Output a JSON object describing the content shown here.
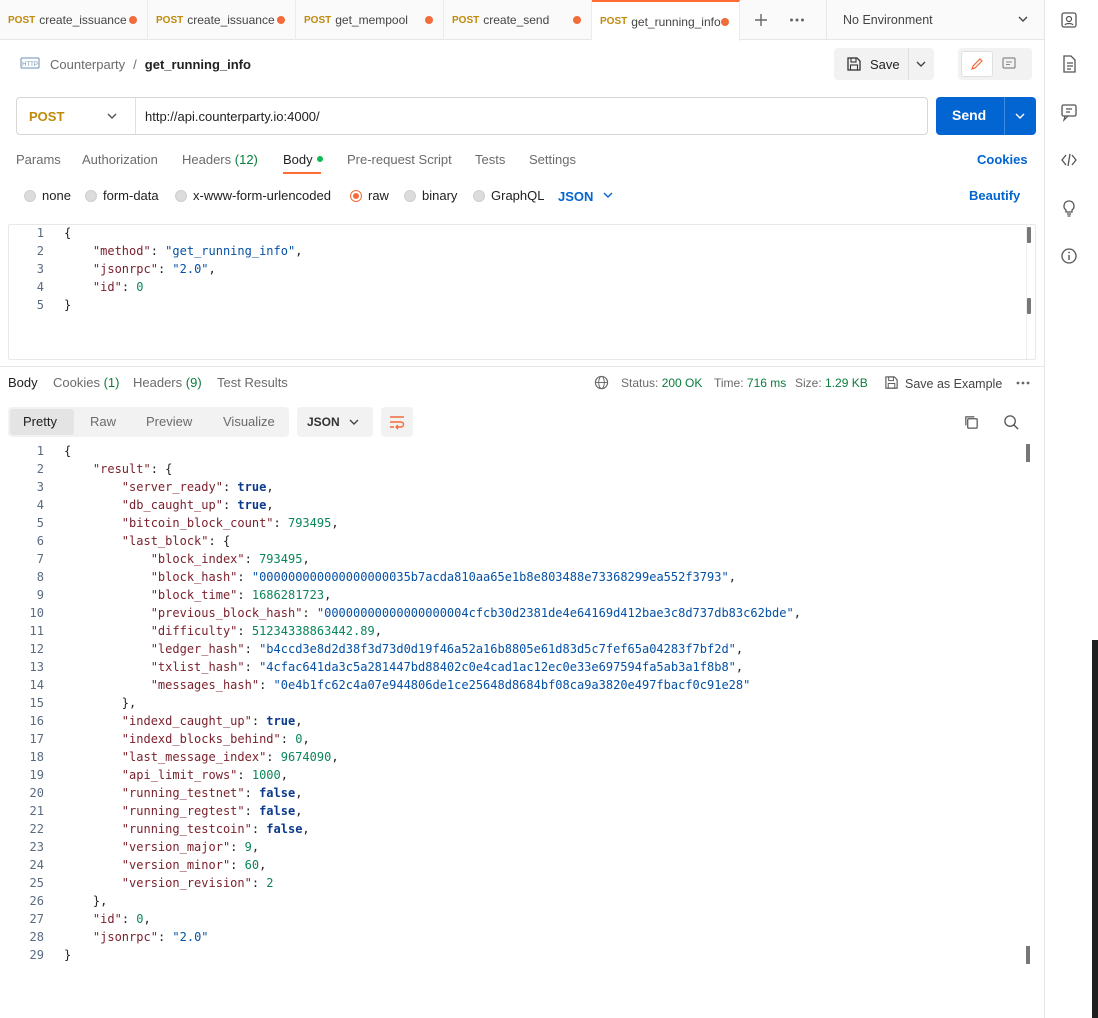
{
  "tabs": [
    {
      "method": "POST",
      "name": "create_issuance",
      "active": false
    },
    {
      "method": "POST",
      "name": "create_issuance",
      "active": false
    },
    {
      "method": "POST",
      "name": "get_mempool",
      "active": false
    },
    {
      "method": "POST",
      "name": "create_send",
      "active": false
    },
    {
      "method": "POST",
      "name": "get_running_info",
      "active": true
    }
  ],
  "environment": {
    "label": "No Environment"
  },
  "breadcrumb": {
    "collection": "Counterparty",
    "separator": "/",
    "request": "get_running_info"
  },
  "toolbar": {
    "save_label": "Save"
  },
  "request": {
    "method": "POST",
    "url": "http://api.counterparty.io:4000/",
    "send_label": "Send"
  },
  "request_tabs": {
    "params": "Params",
    "authorization": "Authorization",
    "headers": "Headers",
    "headers_count": "(12)",
    "body": "Body",
    "pre_request": "Pre-request Script",
    "tests": "Tests",
    "settings": "Settings",
    "cookies": "Cookies"
  },
  "body_types": {
    "none": "none",
    "form_data": "form-data",
    "urlencoded": "x-www-form-urlencoded",
    "raw": "raw",
    "binary": "binary",
    "graphql": "GraphQL",
    "format": "JSON",
    "beautify": "Beautify"
  },
  "request_body_lines": [
    "{",
    "    \"method\": \"get_running_info\",",
    "    \"jsonrpc\": \"2.0\",",
    "    \"id\": 0",
    "}"
  ],
  "response_tabs": {
    "body": "Body",
    "cookies": "Cookies",
    "cookies_count": "(1)",
    "headers": "Headers",
    "headers_count": "(9)",
    "test_results": "Test Results"
  },
  "response_meta": {
    "status_label": "Status:",
    "status_value": "200 OK",
    "time_label": "Time:",
    "time_value": "716 ms",
    "size_label": "Size:",
    "size_value": "1.29 KB",
    "save_example": "Save as Example"
  },
  "response_view": {
    "pretty": "Pretty",
    "raw": "Raw",
    "preview": "Preview",
    "visualize": "Visualize",
    "format": "JSON"
  },
  "response_body_lines": [
    "{",
    "    \"result\": {",
    "        \"server_ready\": true,",
    "        \"db_caught_up\": true,",
    "        \"bitcoin_block_count\": 793495,",
    "        \"last_block\": {",
    "            \"block_index\": 793495,",
    "            \"block_hash\": \"000000000000000000035b7acda810aa65e1b8e803488e73368299ea552f3793\",",
    "            \"block_time\": 1686281723,",
    "            \"previous_block_hash\": \"00000000000000000004cfcb30d2381de4e64169d412bae3c8d737db83c62bde\",",
    "            \"difficulty\": 51234338863442.89,",
    "            \"ledger_hash\": \"b4ccd3e8d2d38f3d73d0d19f46a52a16b8805e61d83d5c7fef65a04283f7bf2d\",",
    "            \"txlist_hash\": \"4cfac641da3c5a281447bd88402c0e4cad1ac12ec0e33e697594fa5ab3a1f8b8\",",
    "            \"messages_hash\": \"0e4b1fc62c4a07e944806de1ce25648d8684bf08ca9a3820e497fbacf0c91e28\"",
    "        },",
    "        \"indexd_caught_up\": true,",
    "        \"indexd_blocks_behind\": 0,",
    "        \"last_message_index\": 9674090,",
    "        \"api_limit_rows\": 1000,",
    "        \"running_testnet\": false,",
    "        \"running_regtest\": false,",
    "        \"running_testcoin\": false,",
    "        \"version_major\": 9,",
    "        \"version_minor\": 60,",
    "        \"version_revision\": 2",
    "    },",
    "    \"id\": 0,",
    "    \"jsonrpc\": \"2.0\"",
    "}"
  ],
  "icons": [
    "http-icon",
    "save-icon",
    "chevron-down-icon",
    "pencil-icon",
    "comment-icon",
    "globe-icon",
    "copy-icon",
    "search-icon",
    "wrap-icon",
    "more-icon",
    "plus-icon",
    "document-icon",
    "code-icon",
    "bulb-icon",
    "info-icon",
    "environment-icon"
  ],
  "colors": {
    "accent": "#ff6c37",
    "primary": "#0265d2",
    "method_post": "#c08a0a",
    "status_ok": "#0a7d3c"
  }
}
